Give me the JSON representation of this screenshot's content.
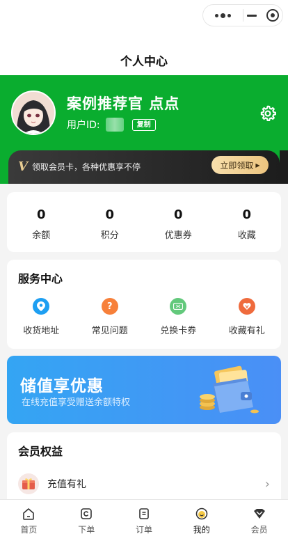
{
  "nav": {
    "title": "个人中心"
  },
  "user": {
    "name": "案例推荐官 点点",
    "id_label": "用户ID:",
    "copy_label": "复制"
  },
  "vip": {
    "badge": "V",
    "text": "领取会员卡，各种优惠享不停",
    "button": "立即领取"
  },
  "stats": [
    {
      "value": "0",
      "label": "余额"
    },
    {
      "value": "0",
      "label": "积分"
    },
    {
      "value": "0",
      "label": "优惠券"
    },
    {
      "value": "0",
      "label": "收藏"
    }
  ],
  "service": {
    "title": "服务中心",
    "items": [
      {
        "label": "收货地址",
        "icon": "location-icon",
        "color": "#1e9ff2"
      },
      {
        "label": "常见问题",
        "icon": "question-icon",
        "color": "#f7803a"
      },
      {
        "label": "兑换卡券",
        "icon": "coupon-icon",
        "color": "#63c97c"
      },
      {
        "label": "收藏有礼",
        "icon": "heart-badge-icon",
        "color": "#ef6b3d"
      }
    ]
  },
  "banner": {
    "title": "储值享优惠",
    "subtitle": "在线充值享受赠送余额特权"
  },
  "benefits": {
    "title": "会员权益",
    "items": [
      {
        "label": "充值有礼"
      }
    ]
  },
  "tabbar": [
    {
      "label": "首页",
      "icon": "home-icon"
    },
    {
      "label": "下单",
      "icon": "order-icon"
    },
    {
      "label": "订单",
      "icon": "list-icon"
    },
    {
      "label": "我的",
      "icon": "profile-icon",
      "active": true
    },
    {
      "label": "会员",
      "icon": "vip-icon"
    }
  ],
  "colors": {
    "primary": "#0aad2f",
    "banner": "#3b9cf5",
    "vip_gold": "#ecc47f"
  }
}
